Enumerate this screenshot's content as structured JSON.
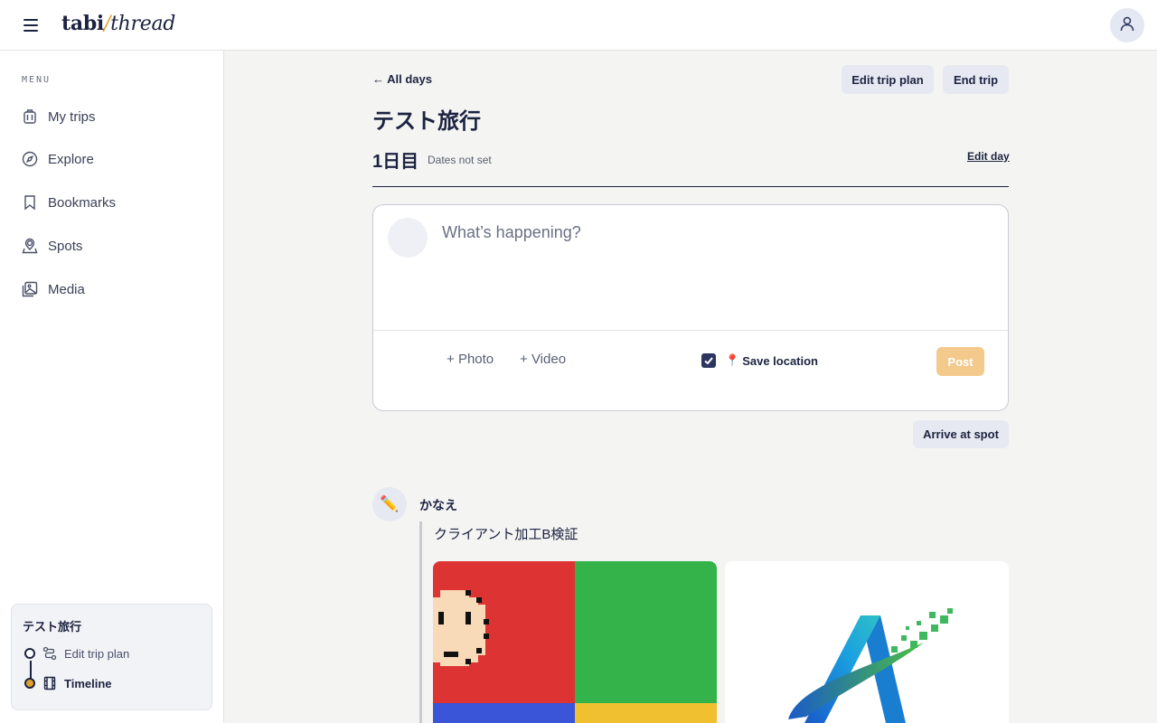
{
  "header": {
    "brand_part1": "tabi",
    "brand_slash": "/",
    "brand_part2": "thread",
    "menu_icon": "hamburger-icon",
    "account_icon": "user-icon"
  },
  "sidebar": {
    "heading": "MENU",
    "items": [
      {
        "label": "My trips",
        "icon": "luggage-icon"
      },
      {
        "label": "Explore",
        "icon": "compass-icon"
      },
      {
        "label": "Bookmarks",
        "icon": "bookmark-icon"
      },
      {
        "label": "Spots",
        "icon": "map-pin-icon"
      },
      {
        "label": "Media",
        "icon": "image-icon"
      }
    ],
    "trip_card": {
      "title": "テスト旅行",
      "steps": [
        {
          "label": "Edit trip plan",
          "icon": "route-icon",
          "active": false
        },
        {
          "label": "Timeline",
          "icon": "film-icon",
          "active": true
        }
      ]
    }
  },
  "main": {
    "back_label": "All days",
    "actions": {
      "edit_plan": "Edit trip plan",
      "end_trip": "End trip"
    },
    "trip_title": "テスト旅行",
    "day_label": "1日目",
    "dates": "Dates not set",
    "edit_day": "Edit day",
    "composer": {
      "placeholder": "What’s happening?",
      "photo": "Photo",
      "video": "Video",
      "save_location": "Save location",
      "save_location_checked": true,
      "post": "Post"
    },
    "arrive_label": "Arrive at spot",
    "post": {
      "author": "かなえ",
      "avatar_emoji": "✏️",
      "text": "クライアント加工B検証"
    }
  },
  "colors": {
    "navy": "#1c2340",
    "accent": "#e0a030",
    "post_disabled": "#f3c98c"
  }
}
